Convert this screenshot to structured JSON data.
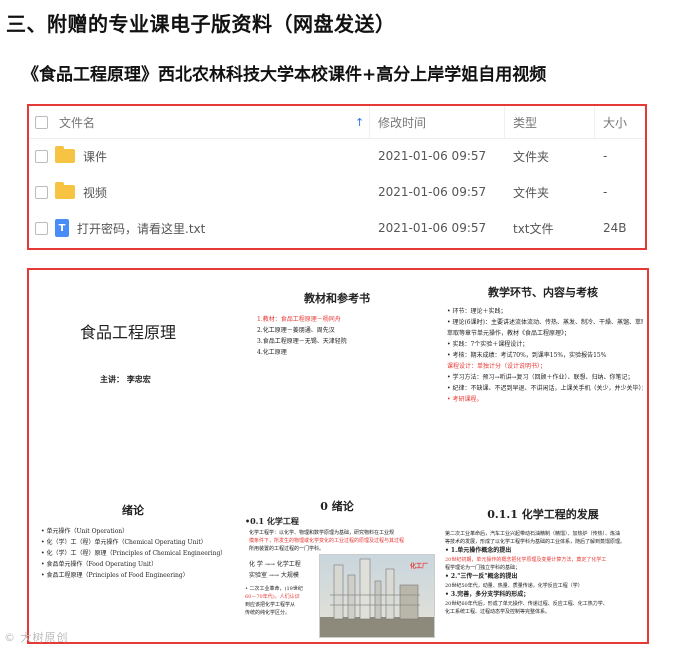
{
  "heading1": "三、附赠的专业课电子版资料（网盘发送）",
  "heading2": "《食品工程原理》西北农林科技大学本校课件+高分上岸学姐自用视频",
  "table": {
    "columns": {
      "name": "文件名",
      "time": "修改时间",
      "type": "类型",
      "size": "大小"
    },
    "rows": [
      {
        "name": "课件",
        "time": "2021-01-06 09:57",
        "type": "文件夹",
        "size": "-",
        "icon": "folder-icon"
      },
      {
        "name": "视频",
        "time": "2021-01-06 09:57",
        "type": "文件夹",
        "size": "-",
        "icon": "folder-icon"
      },
      {
        "name": "打开密码，请看这里.txt",
        "time": "2021-01-06 09:57",
        "type": "txt文件",
        "size": "24B",
        "icon": "txt-file-icon",
        "icon_letter": "T"
      }
    ]
  },
  "slides": {
    "s1": {
      "title": "食品工程原理",
      "author": "主讲：  李忠宏"
    },
    "s2": {
      "title": "教材和参考书",
      "items": [
        "1.教材：食品工程原理－杨同舟",
        "2.化工原理－姜朋通、周先汉",
        "3.食品工程原理－无锡、天津轻院",
        "4.化工原理"
      ]
    },
    "s3": {
      "title": "教学环节、内容与考核",
      "items": [
        "• 环节：理论＋实践；",
        "• 理论(6课时)：主要讲述流体流动、传热、蒸发、制冷、干燥、蒸馏、萃取等",
        "  萃取等章节单元操作，教材《食品工程原理》；",
        "• 实践：7个实验＋课程设计；",
        "• 考核：期末成绩：考试70%，到课率15%，实验报告15%",
        "    课程设计：单独计分（设计说明书）；",
        "• 学习方法：预习→听讲→复习（回顾＋作业）、联想、归纳、你笔记；",
        "• 纪律：不缺课、不迟到早退、不讲闲话，上课关手机（关少，并少关毕）；",
        "• 考研课程。"
      ]
    },
    "s4": {
      "title": "绪论",
      "items": [
        "• 单元操作（Unit Operation）",
        "• 化（学）工（程）单元操作（Chemical Operating Unit）",
        "• 化（学）工（程）原理（Principles of Chemical Engineering）",
        "• 食品单元操作（Food Operating Unit）",
        "• 食品工程原理（Principles of Food Engineering）"
      ]
    },
    "s5": {
      "title": "0  绪论",
      "subtitle": "•0.1 化学工程",
      "lines": [
        "化学工程学：以化学、物理和数学原理为基础，研究物料在工业规",
        "模条件下，所发生的物理或化学变化的工业过程的原理及过程与其过程",
        "所用装置的工程过程的一门学科。"
      ],
      "kv": [
        "化  学 →→ 化学工程",
        "实验室 →→ 大规模"
      ],
      "bullet": [
        "• 二次工业革命，(19世纪",
        "60－70年代)，人们认识",
        "到应该把化学工程学从",
        "传统的纯化学区分。"
      ],
      "photo_label": "化工厂"
    },
    "s6": {
      "title": "0.1.1 化学工程的发展",
      "items": [
        "第二次工业革命后，汽车工业兴起带动石油精制（精馏）、加热炉（传热）、炼油",
        "等技术的发展，形成了以化学工程学科为基础的工业体系，随后了解到蒸馏原理。",
        "• 1.单元操作概念的提出",
        "    20世纪初期，单元操作的概念把化学原理及变量计算方法，奠定了化学工",
        "    程学理论为一门独立学科的基础；",
        "• 2.\"三传一反\"概念的提出",
        "    20世纪50年代，动量、热量、质量传递，化学反应工程（学）",
        "• 3.完善，多分支学科的形成；",
        "    20世纪60年代后，形成了单元操作、传递过程、反应工程、化工热力学、",
        "    化工系统工程、过程动态学及控制等完整体系。"
      ]
    }
  },
  "watermark": "© 大树原创"
}
